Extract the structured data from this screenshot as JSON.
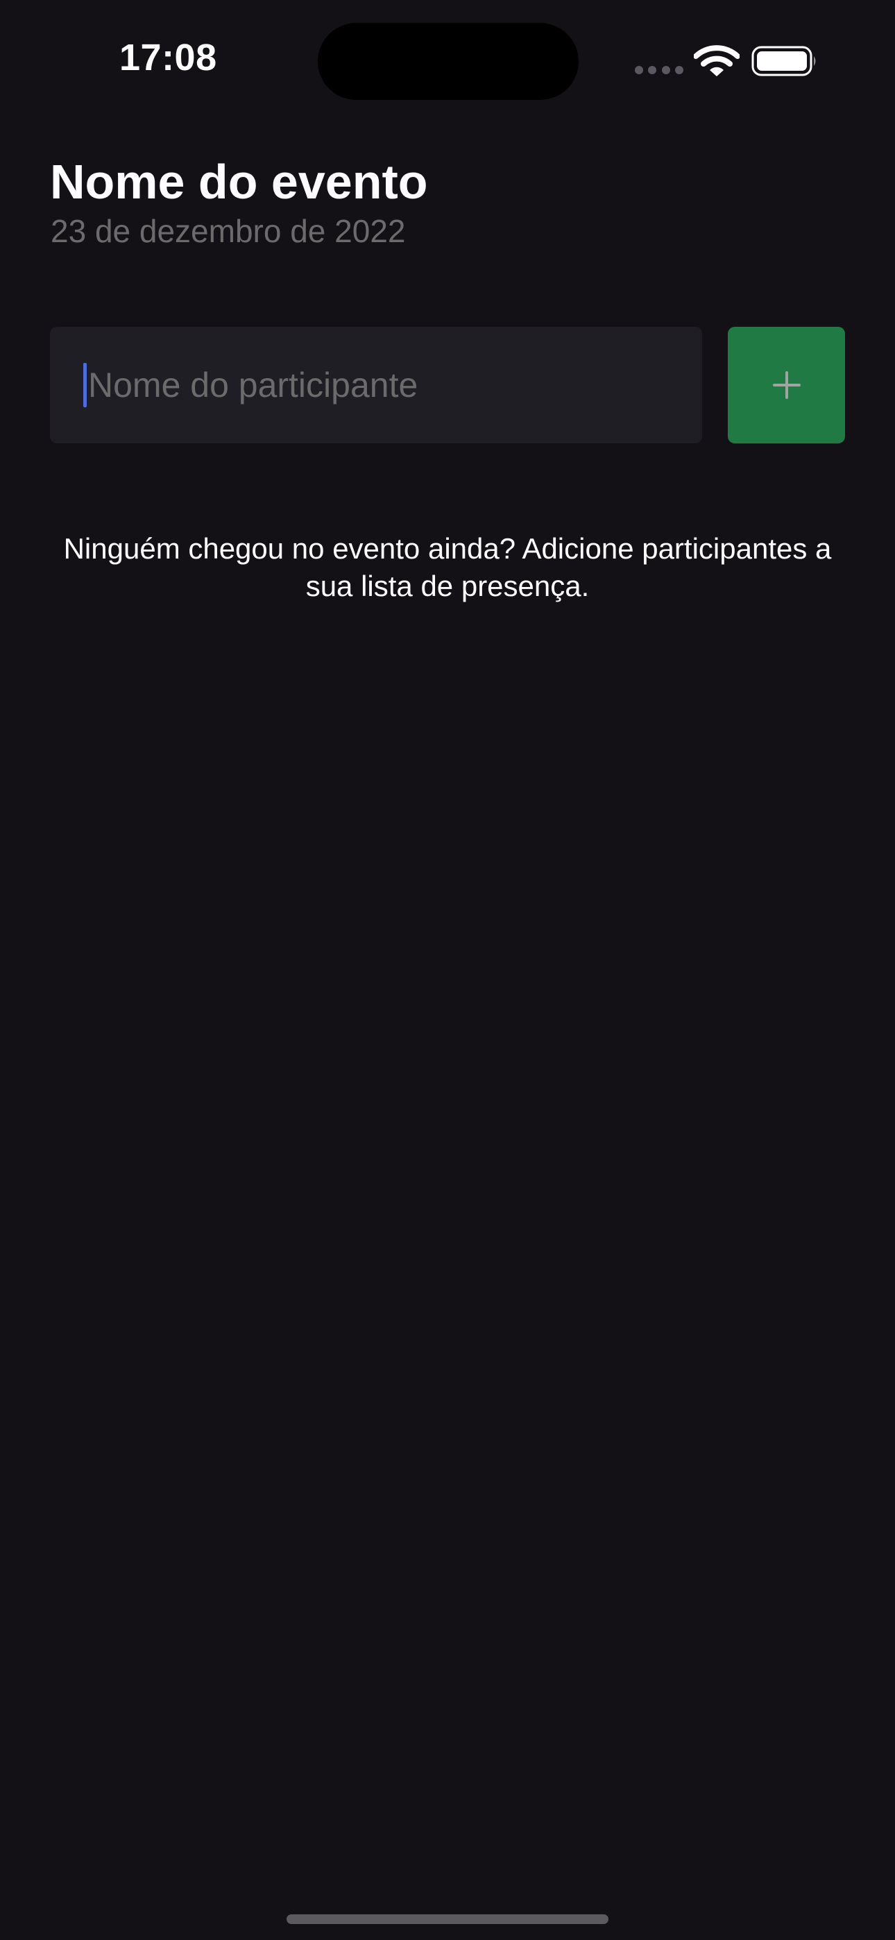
{
  "status_bar": {
    "time": "17:08",
    "icons": [
      "cellular-signal-icon",
      "wifi-icon",
      "battery-icon"
    ]
  },
  "event": {
    "title": "Nome do evento",
    "date": "23 de dezembro de 2022"
  },
  "form": {
    "participant_placeholder": "Nome do participante",
    "participant_value": "",
    "add_button_icon": "plus-icon"
  },
  "empty_state": {
    "message": "Ninguém chegou no evento ainda? Adicione participantes a sua lista de presença."
  },
  "colors": {
    "background": "#131016",
    "input_background": "#1F1E25",
    "add_button": "#1F7A43",
    "muted_text": "#6B6B6B",
    "caret": "#4F6BE0"
  }
}
